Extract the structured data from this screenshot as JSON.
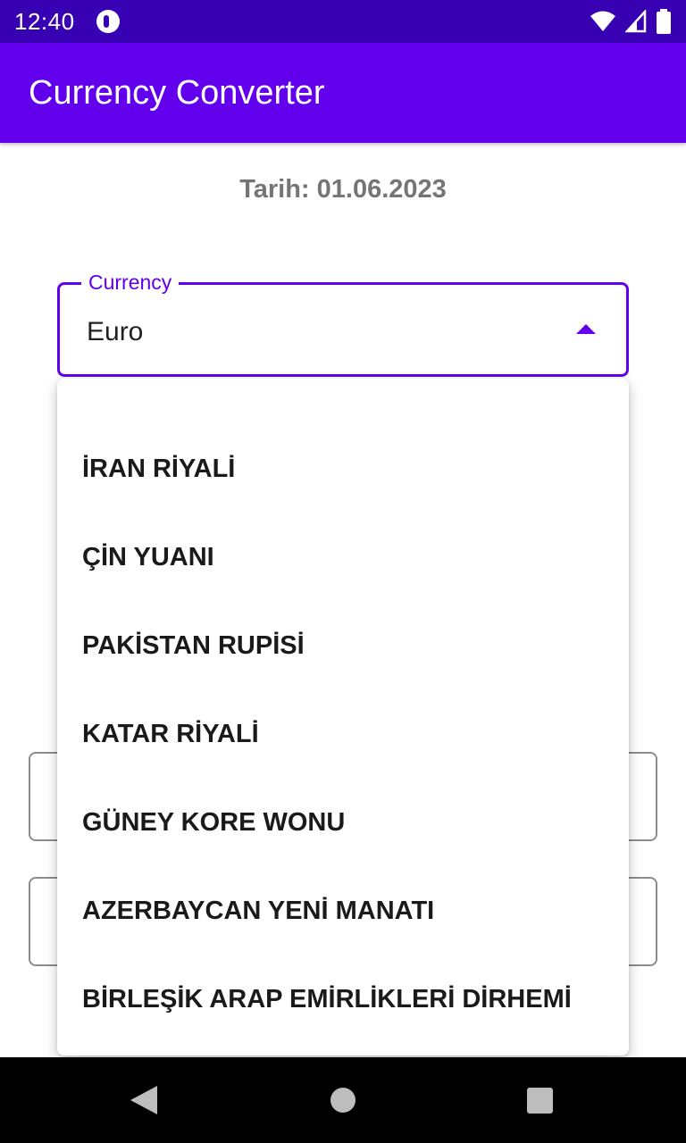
{
  "status_bar": {
    "time": "12:40",
    "icons": [
      "app-notification-icon",
      "wifi-icon",
      "signal-icon",
      "battery-icon"
    ]
  },
  "toolbar": {
    "title": "Currency Converter",
    "color": "#6200ee"
  },
  "date_label": "Tarih: 01.06.2023",
  "currency_field": {
    "label": "Currency",
    "value": "Euro",
    "expanded": true
  },
  "dropdown": {
    "items": [
      "İRAN RİYALİ",
      "ÇİN YUANI",
      "PAKİSTAN RUPİSİ",
      "KATAR RİYALİ",
      "GÜNEY KORE WONU",
      "AZERBAYCAN YENİ MANATI",
      "BİRLEŞİK ARAP EMİRLİKLERİ DİRHEMİ"
    ]
  },
  "colors": {
    "primary": "#6200ee",
    "primary_dark": "#3700b3"
  },
  "nav_bar": {
    "buttons": [
      "back-icon",
      "home-icon",
      "recents-icon"
    ]
  }
}
